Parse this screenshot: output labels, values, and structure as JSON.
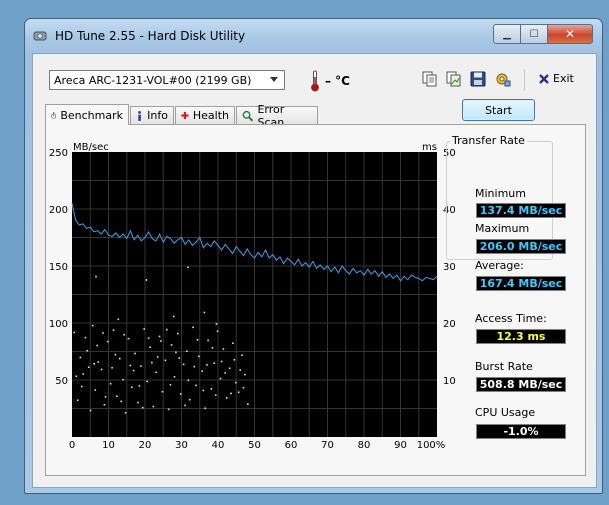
{
  "window": {
    "title": "HD Tune 2.55 - Hard Disk Utility"
  },
  "toolbar": {
    "drive": "Areca   ARC-1231-VOL#00 (2199 GB)",
    "temperature": "– °C",
    "exit_label": "Exit"
  },
  "tabs": [
    {
      "label": "Benchmark",
      "active": true
    },
    {
      "label": "Info"
    },
    {
      "label": "Health"
    },
    {
      "label": "Error Scan"
    }
  ],
  "start_label": "Start",
  "stats": {
    "transfer_rate_title": "Transfer Rate",
    "minimum_label": "Minimum",
    "minimum": "137.4 MB/sec",
    "maximum_label": "Maximum",
    "maximum": "206.0 MB/sec",
    "average_label": "Average:",
    "average": "167.4 MB/sec",
    "access_time_label": "Access Time:",
    "access_time": "12.3 ms",
    "burst_rate_label": "Burst Rate",
    "burst_rate": "508.8 MB/sec",
    "cpu_usage_label": "CPU Usage",
    "cpu_usage": "-1.0%"
  },
  "chart_data": {
    "type": "line",
    "left_unit": "MB/sec",
    "right_unit": "ms",
    "x_ticks": [
      "0",
      "10",
      "20",
      "30",
      "40",
      "50",
      "60",
      "70",
      "80",
      "90",
      "100%"
    ],
    "y_left_ticks": [
      "250",
      "200",
      "150",
      "100",
      "50"
    ],
    "y_right_ticks": [
      "50",
      "40",
      "30",
      "20",
      "10"
    ],
    "xlim": [
      0,
      100
    ],
    "ylim_left": [
      0,
      250
    ],
    "ylim_right": [
      0,
      50
    ],
    "grid": true,
    "series": [
      {
        "color": "#3f9fe8",
        "x": [
          0,
          1,
          2,
          3,
          4,
          5,
          6,
          7,
          8,
          9,
          10,
          11,
          12,
          13,
          14,
          15,
          16,
          17,
          18,
          19,
          20,
          21,
          22,
          23,
          24,
          25,
          26,
          27,
          28,
          29,
          30,
          31,
          32,
          33,
          34,
          35,
          36,
          37,
          38,
          39,
          40,
          41,
          42,
          43,
          44,
          45,
          46,
          47,
          48,
          49,
          50,
          51,
          52,
          53,
          54,
          55,
          56,
          57,
          58,
          59,
          60,
          61,
          62,
          63,
          64,
          65,
          66,
          67,
          68,
          69,
          70,
          71,
          72,
          73,
          74,
          75,
          76,
          77,
          78,
          79,
          80,
          81,
          82,
          83,
          84,
          85,
          86,
          87,
          88,
          89,
          90,
          91,
          92,
          93,
          94,
          95,
          96,
          97,
          98,
          99,
          100
        ],
        "y": [
          205,
          190,
          186,
          187,
          183,
          184,
          180,
          181,
          178,
          182,
          177,
          176,
          179,
          175,
          178,
          174,
          181,
          173,
          177,
          172,
          175,
          180,
          174,
          172,
          178,
          171,
          176,
          174,
          170,
          173,
          175,
          169,
          173,
          168,
          171,
          175,
          166,
          170,
          167,
          172,
          168,
          164,
          169,
          165,
          161,
          167,
          163,
          159,
          165,
          160,
          157,
          162,
          158,
          164,
          157,
          160,
          155,
          158,
          152,
          157,
          154,
          151,
          156,
          150,
          153,
          149,
          154,
          148,
          151,
          147,
          150,
          145,
          149,
          144,
          150,
          146,
          143,
          148,
          144,
          146,
          142,
          147,
          143,
          146,
          141,
          145,
          140,
          143,
          139,
          142,
          137,
          141,
          138,
          142,
          140,
          139,
          137,
          140,
          139,
          138,
          141
        ]
      }
    ],
    "access_points": [
      [
        0.5,
        18.4
      ],
      [
        1.5,
        6.5
      ],
      [
        2.2,
        14.0
      ],
      [
        3.0,
        11.1
      ],
      [
        4.1,
        15.2
      ],
      [
        5.0,
        4.7
      ],
      [
        5.6,
        19.6
      ],
      [
        6.3,
        8.3
      ],
      [
        7.1,
        13.2
      ],
      [
        8.0,
        11.9
      ],
      [
        8.8,
        5.7
      ],
      [
        9.7,
        16.8
      ],
      [
        10.5,
        9.4
      ],
      [
        11.3,
        18.8
      ],
      [
        12.2,
        7.2
      ],
      [
        13.0,
        13.8
      ],
      [
        13.9,
        10.1
      ],
      [
        14.6,
        4.3
      ],
      [
        15.4,
        17.3
      ],
      [
        16.3,
        8.8
      ],
      [
        17.2,
        14.7
      ],
      [
        18.0,
        6.1
      ],
      [
        18.8,
        12.5
      ],
      [
        19.7,
        19.0
      ],
      [
        20.5,
        9.8
      ],
      [
        21.3,
        15.8
      ],
      [
        22.2,
        5.4
      ],
      [
        23.0,
        11.4
      ],
      [
        23.9,
        17.7
      ],
      [
        24.7,
        8.0
      ],
      [
        25.5,
        13.5
      ],
      [
        26.4,
        4.9
      ],
      [
        27.2,
        16.2
      ],
      [
        28.0,
        10.6
      ],
      [
        28.9,
        18.2
      ],
      [
        29.7,
        7.6
      ],
      [
        30.5,
        12.8
      ],
      [
        31.4,
        15.1
      ],
      [
        32.2,
        6.6
      ],
      [
        33.1,
        19.3
      ],
      [
        33.9,
        9.1
      ],
      [
        34.7,
        14.2
      ],
      [
        35.6,
        11.6
      ],
      [
        36.4,
        5.1
      ],
      [
        37.2,
        17.0
      ],
      [
        38.1,
        8.5
      ],
      [
        38.9,
        13.0
      ],
      [
        39.8,
        18.6
      ],
      [
        40.6,
        10.3
      ],
      [
        41.4,
        15.5
      ],
      [
        42.3,
        6.9
      ],
      [
        43.1,
        12.1
      ],
      [
        44.0,
        16.5
      ],
      [
        44.8,
        9.6
      ],
      [
        45.6,
        7.9
      ],
      [
        46.5,
        14.4
      ],
      [
        47.3,
        11.0
      ],
      [
        48.1,
        5.8
      ],
      [
        2.6,
        8.9
      ],
      [
        4.5,
        12.3
      ],
      [
        6.8,
        16.1
      ],
      [
        9.1,
        7.1
      ],
      [
        11.8,
        14.5
      ],
      [
        14.2,
        18.0
      ],
      [
        16.8,
        11.7
      ],
      [
        19.3,
        5.2
      ],
      [
        21.8,
        13.1
      ],
      [
        24.3,
        16.9
      ],
      [
        26.9,
        9.2
      ],
      [
        29.3,
        13.9
      ],
      [
        31.8,
        10.0
      ],
      [
        34.3,
        17.1
      ],
      [
        36.9,
        12.7
      ],
      [
        39.3,
        7.4
      ],
      [
        41.9,
        11.3
      ],
      [
        44.4,
        13.6
      ],
      [
        46.9,
        8.7
      ],
      [
        1.1,
        10.7
      ],
      [
        3.6,
        17.5
      ],
      [
        6.0,
        12.9
      ],
      [
        8.4,
        18.3
      ],
      [
        10.9,
        12.2
      ],
      [
        13.4,
        6.3
      ],
      [
        15.9,
        12.6
      ],
      [
        18.4,
        9.0
      ],
      [
        20.9,
        17.4
      ],
      [
        23.4,
        14.1
      ],
      [
        25.9,
        18.9
      ],
      [
        28.4,
        14.9
      ],
      [
        30.9,
        5.6
      ],
      [
        33.4,
        12.4
      ],
      [
        35.9,
        8.2
      ],
      [
        38.4,
        15.7
      ],
      [
        40.9,
        13.3
      ],
      [
        43.5,
        7.7
      ],
      [
        46.0,
        11.8
      ],
      [
        12.6,
        20.7
      ],
      [
        27.8,
        21.2
      ],
      [
        36.2,
        21.9
      ],
      [
        20.3,
        27.6
      ],
      [
        31.7,
        29.8
      ],
      [
        6.5,
        28.2
      ],
      [
        39.5,
        19.9
      ]
    ]
  }
}
